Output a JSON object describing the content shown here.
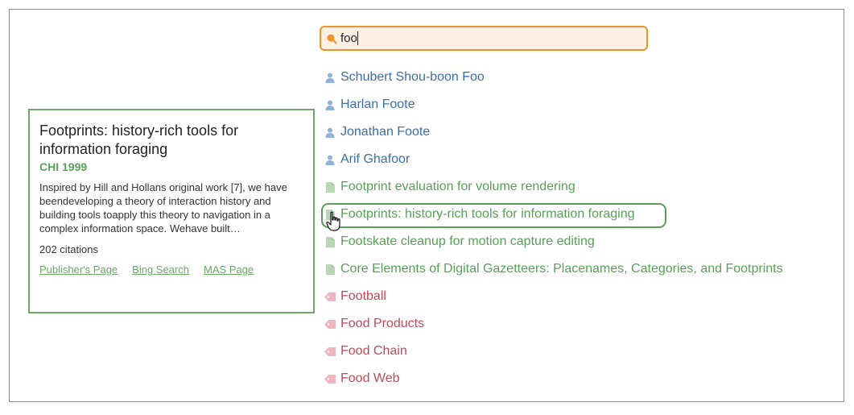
{
  "search": {
    "query": "foo",
    "icon": "search-icon"
  },
  "results": [
    {
      "type": "person",
      "label": "Schubert Shou-boon Foo",
      "icon": "person-icon"
    },
    {
      "type": "person",
      "label": "Harlan Foote",
      "icon": "person-icon"
    },
    {
      "type": "person",
      "label": "Jonathan Foote",
      "icon": "person-icon"
    },
    {
      "type": "person",
      "label": "Arif Ghafoor",
      "icon": "person-icon"
    },
    {
      "type": "paper",
      "label": "Footprint evaluation for volume rendering",
      "icon": "document-icon"
    },
    {
      "type": "paper",
      "label": "Footprints: history-rich tools for information foraging",
      "icon": "document-icon",
      "selected": true
    },
    {
      "type": "paper",
      "label": "Footskate cleanup for motion capture editing",
      "icon": "document-icon"
    },
    {
      "type": "paper",
      "label": "Core Elements of Digital Gazetteers: Placenames, Categories, and Footprints",
      "icon": "document-icon"
    },
    {
      "type": "topic",
      "label": "Football",
      "icon": "tag-icon"
    },
    {
      "type": "topic",
      "label": "Food Products",
      "icon": "tag-icon"
    },
    {
      "type": "topic",
      "label": "Food Chain",
      "icon": "tag-icon"
    },
    {
      "type": "topic",
      "label": "Food Web",
      "icon": "tag-icon"
    }
  ],
  "detail": {
    "title": "Footprints: history-rich tools for information foraging",
    "venue": "CHI 1999",
    "abstract": "Inspired by Hill and Hollans original work [7], we have beendeveloping a theory of interaction history and building tools toapply this theory to navigation in a complex information space. Wehave built…",
    "citations": "202 citations",
    "links": [
      "Publisher's Page",
      "Bing Search",
      "MAS Page"
    ]
  },
  "colors": {
    "search_border": "#f0932b",
    "search_bg": "#fdf1e3",
    "person": "#3b6fa8",
    "paper": "#57a256",
    "topic": "#c04a5b",
    "card_border": "#6ea76a"
  }
}
